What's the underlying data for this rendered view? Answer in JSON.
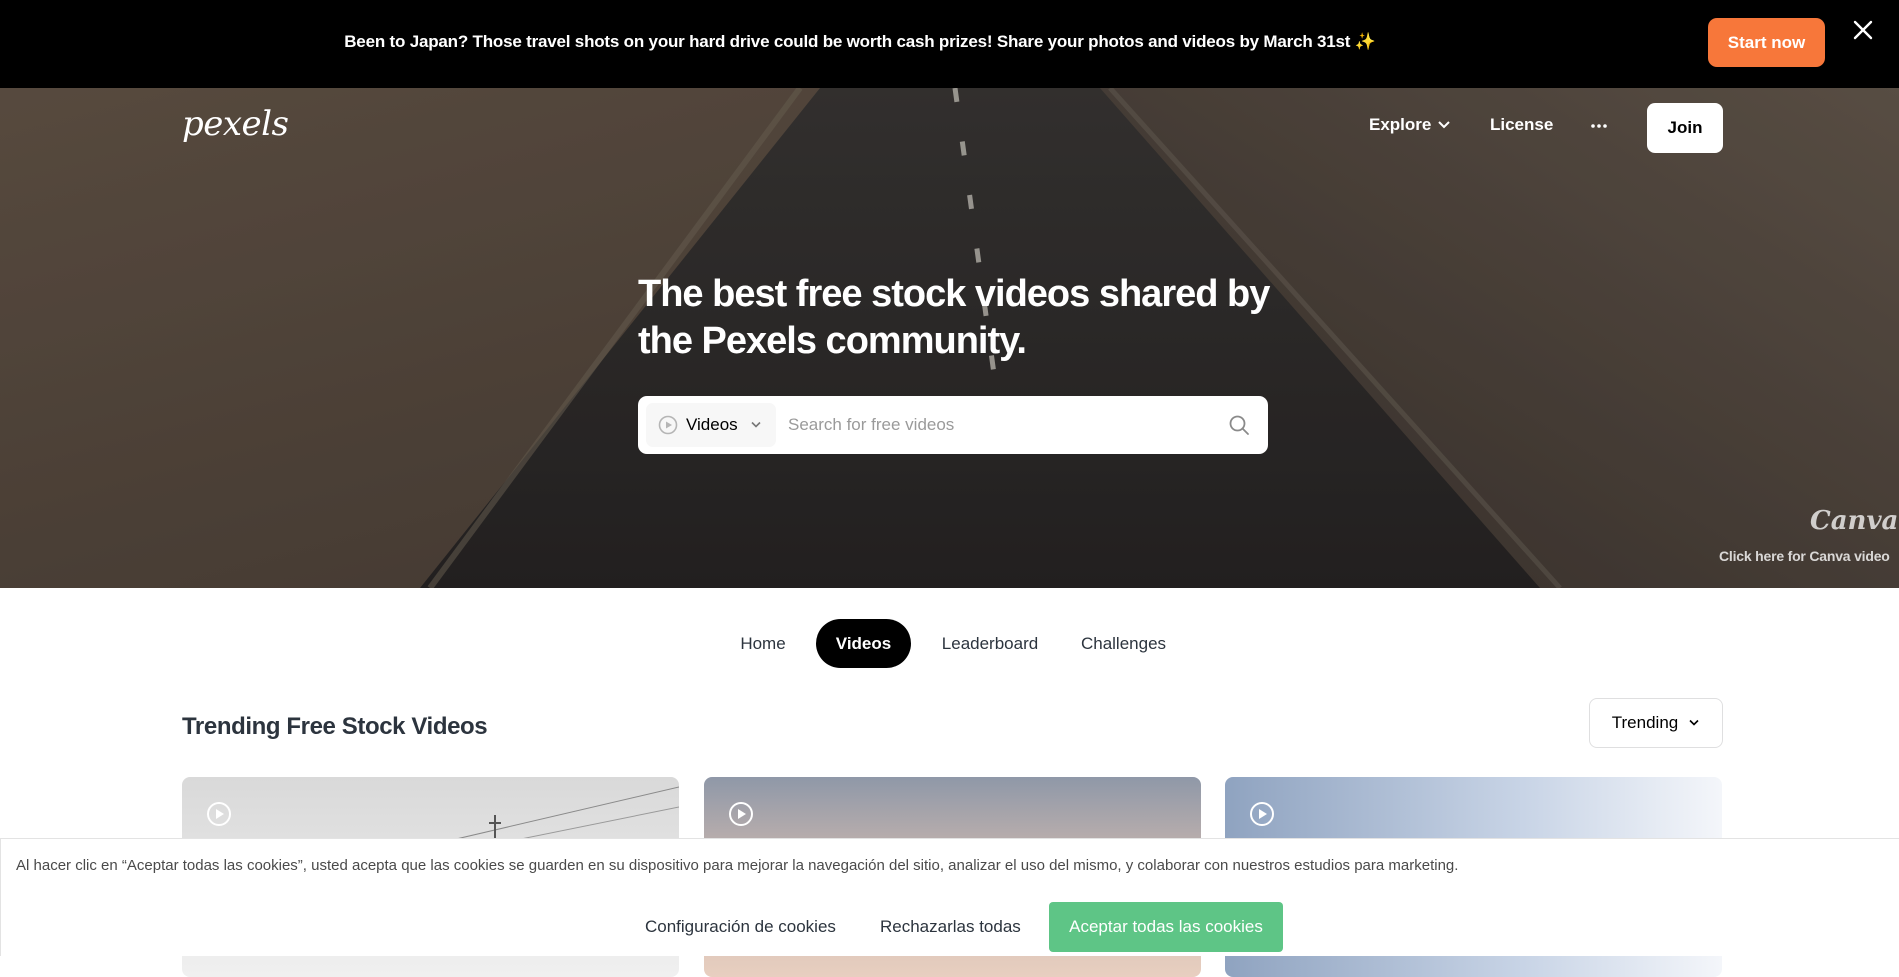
{
  "promo": {
    "text": "Been to Japan? Those travel shots on your hard drive could be worth cash prizes! Share your photos and videos by March 31st ✨",
    "button": "Start now",
    "close_icon": "close-icon"
  },
  "header": {
    "logo": "pexels",
    "nav": {
      "explore": "Explore",
      "license": "License",
      "more_icon": "more-horizontal-icon",
      "join": "Join"
    }
  },
  "hero": {
    "title": "The best free stock videos shared by the Pexels community.",
    "search": {
      "type_label": "Videos",
      "placeholder": "Search for free videos"
    },
    "canva": {
      "logo": "Canva",
      "link": "Click here for Canva video"
    }
  },
  "tabs": [
    {
      "label": "Home",
      "active": false
    },
    {
      "label": "Videos",
      "active": true
    },
    {
      "label": "Leaderboard",
      "active": false
    },
    {
      "label": "Challenges",
      "active": false
    }
  ],
  "section": {
    "title": "Trending Free Stock Videos",
    "sort": "Trending"
  },
  "cookie": {
    "text": "Al hacer clic en “Aceptar todas las cookies”, usted acepta que las cookies se guarden en su dispositivo para mejorar la navegación del sitio, analizar el uso del mismo, y colaborar con nuestros estudios para marketing.",
    "settings": "Configuración de cookies",
    "reject": "Rechazarlas todas",
    "accept": "Aceptar todas las cookies"
  },
  "colors": {
    "accent_orange": "#f7773a",
    "accept_green": "#5ec586",
    "tab_active": "#000000"
  }
}
